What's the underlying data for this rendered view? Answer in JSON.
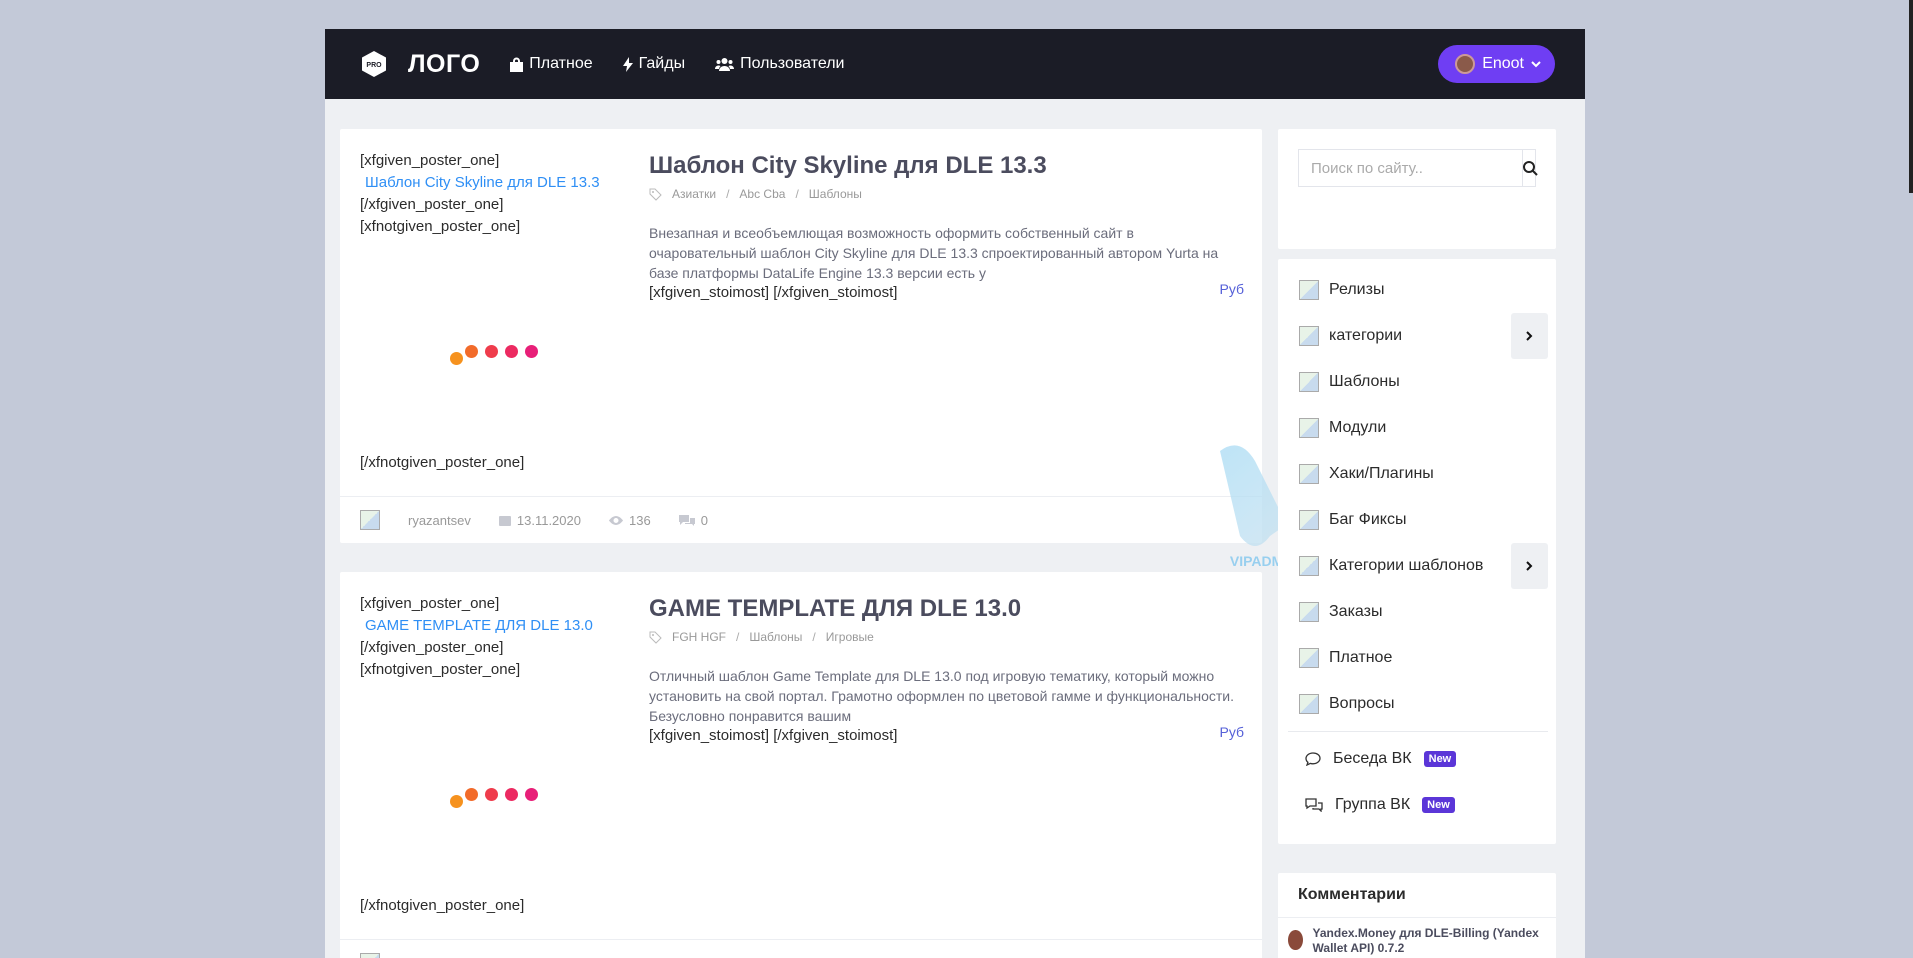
{
  "header": {
    "logo_badge": "PRO",
    "logo_text": "ЛОГО",
    "nav": [
      {
        "label": "Платное",
        "icon": "shopping-bag-icon"
      },
      {
        "label": "Гайды",
        "icon": "bolt-icon"
      },
      {
        "label": "Пользователи",
        "icon": "users-icon"
      }
    ],
    "user_name": "Enoot",
    "accent": "#6f3ef3"
  },
  "posts": [
    {
      "poster_open": "[xfgiven_poster_one]",
      "poster_link": "Шаблон City Skyline для DLE 13.3",
      "poster_close": "[/xfgiven_poster_one]",
      "notgiven_open": "[xfnotgiven_poster_one]",
      "notgiven_close": "[/xfnotgiven_poster_one]",
      "title": "Шаблон City Skyline для DLE 13.3",
      "cats": [
        "Азиатки",
        "Abc Cba",
        "Шаблоны"
      ],
      "desc": "Внезапная и всеобъемлющая возможность оформить собственный сайт в очаровательный шаблон City Skyline для DLE 13.3 спроектированный автором Yurta на базе платформы DataLife Engine 13.3 версии есть у",
      "stoimost": "[xfgiven_stoimost] [/xfgiven_stoimost]",
      "rub": "Руб",
      "author": "ryazantsev",
      "date": "13.11.2020",
      "views": "136",
      "comments": "0"
    },
    {
      "poster_open": "[xfgiven_poster_one]",
      "poster_link": "GAME TEMPLATE ДЛЯ DLE 13.0",
      "poster_close": "[/xfgiven_poster_one]",
      "notgiven_open": "[xfnotgiven_poster_one]",
      "notgiven_close": "[/xfnotgiven_poster_one]",
      "title": "GAME TEMPLATE ДЛЯ DLE 13.0",
      "cats": [
        "FGH HGF",
        "Шаблоны",
        "Игровые"
      ],
      "desc": "Отличный шаблон Game Template для DLE 13.0 под игровую тематику, который можно установить на свой портал. Грамотно оформлен по цветовой гамме и функциональности. Безусловно понравится вашим",
      "stoimost": "[xfgiven_stoimost] [/xfgiven_stoimost]",
      "rub": "Руб"
    }
  ],
  "sidebar": {
    "search_placeholder": "Поиск по сайту..",
    "menu": [
      {
        "label": "Релизы",
        "has_arrow": false
      },
      {
        "label": "категории",
        "has_arrow": true
      },
      {
        "label": "Шаблоны",
        "has_arrow": false
      },
      {
        "label": "Модули",
        "has_arrow": false
      },
      {
        "label": "Хаки/Плагины",
        "has_arrow": false
      },
      {
        "label": "Баг Фиксы",
        "has_arrow": false
      },
      {
        "label": "Категории шаблонов",
        "has_arrow": true
      },
      {
        "label": "Заказы",
        "has_arrow": false
      },
      {
        "label": "Платное",
        "has_arrow": false
      },
      {
        "label": "Вопросы",
        "has_arrow": false
      }
    ],
    "links": [
      {
        "label": "Беседа ВК",
        "badge": "New",
        "icon": "chat-icon"
      },
      {
        "label": "Группа ВК",
        "badge": "New",
        "icon": "chats-icon"
      }
    ],
    "comments_title": "Комментарии",
    "comment_text": "Yandex.Money для DLE-Billing (Yandex Wallet API) 0.7.2"
  },
  "watermark": "VIPADMIN.CLUB"
}
